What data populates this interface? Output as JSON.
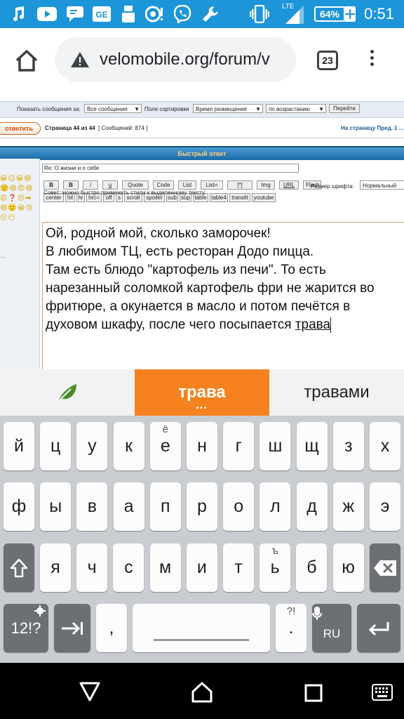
{
  "status_bar": {
    "network": "LTE",
    "battery": "64%",
    "time": "0:51",
    "icons": [
      "music-icon",
      "youtube-icon",
      "messages-icon",
      "ge-icon",
      "keyboard-icon",
      "volume-alert-icon",
      "viber-icon",
      "wrench-icon",
      "vibrate-icon",
      "signal-icon",
      "battery-icon",
      "charging-icon"
    ]
  },
  "browser": {
    "url": "velomobile.org/forum/v",
    "tab_count": "23"
  },
  "forum": {
    "show_posts_label": "Показать сообщения за:",
    "show_posts_value": "Все сообщения",
    "sort_field_label": "Поле сортировки",
    "sort_field_value": "Время размещения",
    "sort_order_value": "по возрастанию",
    "go_button": "Перейти",
    "reply_button": "ответить",
    "page_info": "Страница 44 из 44",
    "message_count": "[ Сообщений: 874 ]",
    "to_page": "На страницу Пред.  1 ...",
    "quick_reply_title": "Быстрый ответ",
    "subject": "Re: О жизни и о себе",
    "font_size_label": "Размер шрифта:",
    "font_size_value": "Нормальный",
    "tip": "Совет: можно быстро применить стили к выделенному тексту.",
    "toolbar_row1": [
      "B",
      "B",
      "i",
      "u",
      "Quote",
      "Code",
      "List",
      "List=",
      "[*]",
      "Img",
      "URL",
      "Flash"
    ],
    "toolbar_row2": [
      "center",
      "hil",
      "hr",
      "hrc=",
      "off",
      "s",
      "scroll",
      "spoiler",
      "sub",
      "sup",
      "table",
      "table4",
      "translit",
      "youtube"
    ],
    "smilies": "😀😐😀😄🙂😆😠😄😡❓😣➡😄🙂😀😢😗😶",
    "editor_lines": [
      "Ой, родной мой, сколько заморочек!",
      "В любимом ТЦ, есть ресторан Додо пицца.",
      "Там есть блюдо \"картофель из печи\". То есть",
      "нарезанный соломкой картофель фри не жарится во",
      "фритюре, а окунается в масло и потом печётся в",
      "духовом шкафу, после чего посыпается "
    ],
    "editor_last_word": "трава"
  },
  "suggestions": {
    "left_icon": "leaf-icon",
    "middle": "трава",
    "middle_dots": "•••",
    "right": "травами"
  },
  "keyboard": {
    "row1": [
      "й",
      "ц",
      "у",
      "к",
      "е",
      "н",
      "г",
      "ш",
      "щ",
      "з",
      "х"
    ],
    "row1_hint": "ё",
    "row2": [
      "ф",
      "ы",
      "в",
      "а",
      "п",
      "р",
      "о",
      "л",
      "д",
      "ж",
      "э"
    ],
    "row3": [
      "я",
      "ч",
      "с",
      "м",
      "и",
      "т",
      "ь",
      "б",
      "ю"
    ],
    "row3_hint": "ъ",
    "numbers_key": "12!?",
    "comma_key": ",",
    "period_key": ".",
    "period_hint": "?!",
    "lang_key": "RU",
    "accent_color": "#f5821f"
  }
}
